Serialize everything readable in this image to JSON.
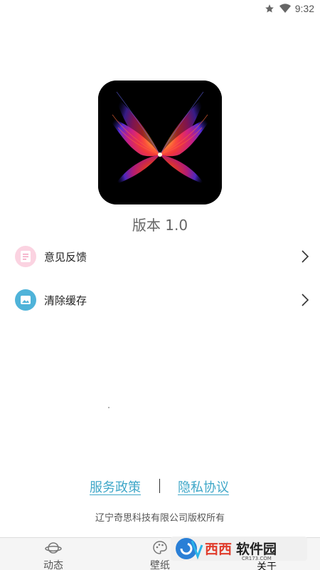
{
  "status_bar": {
    "time": "9:32",
    "icons": [
      "star-icon",
      "wifi-icon"
    ]
  },
  "app": {
    "logo_icon": "butterfly-logo",
    "version": "版本 1.0"
  },
  "menu": {
    "items": [
      {
        "label": "意见反馈",
        "icon": "feedback-icon",
        "icon_color": "#f5c6d6"
      },
      {
        "label": "清除缓存",
        "icon": "image-icon",
        "icon_color": "#4fb3d9"
      }
    ]
  },
  "links": {
    "service_policy": "服务政策",
    "privacy_agreement": "隐私协议",
    "color": "#3fa7c8"
  },
  "footer": {
    "copyright": "辽宁奇思科技有限公司版权所有"
  },
  "bottom_nav": {
    "tabs": [
      {
        "label": "动态",
        "icon": "planet-icon"
      },
      {
        "label": "壁纸",
        "icon": "palette-icon"
      },
      {
        "label": "关于",
        "icon": "info-icon",
        "active": true
      }
    ]
  },
  "watermark": {
    "text": "西西软件园",
    "subtext": "CR173.COM"
  }
}
